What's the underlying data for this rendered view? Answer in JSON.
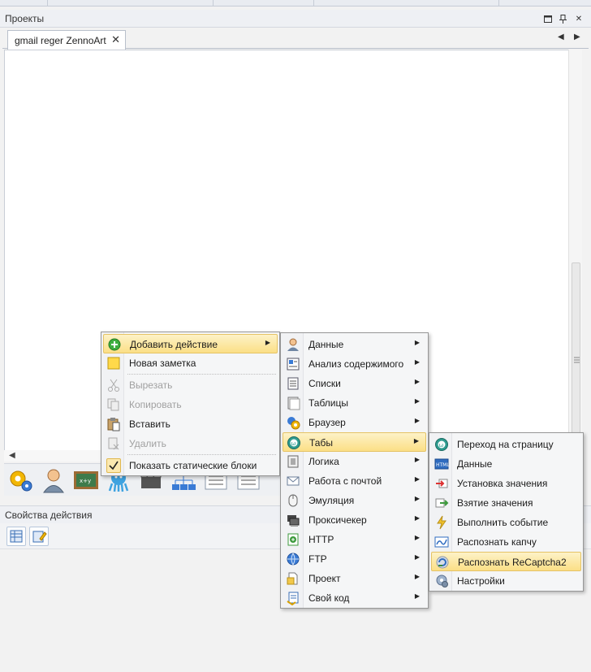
{
  "projects_panel": {
    "title": "Проекты",
    "tab_label": "gmail reger ZennoArt"
  },
  "props_panel": {
    "title": "Свойства действия"
  },
  "context_menu": {
    "items": [
      {
        "label": "Добавить действие",
        "icon": "add-icon",
        "submenu": true,
        "highlighted": true
      },
      {
        "label": "Новая заметка",
        "icon": "note-icon"
      },
      {
        "label": "Вырезать",
        "icon": "scissors-icon",
        "disabled": true
      },
      {
        "label": "Копировать",
        "icon": "copy-icon",
        "disabled": true
      },
      {
        "label": "Вставить",
        "icon": "paste-icon"
      },
      {
        "label": "Удалить",
        "icon": "delete-icon",
        "disabled": true
      },
      {
        "label": "Показать статические блоки",
        "icon": "check-icon",
        "checked": true
      }
    ]
  },
  "actions_submenu": {
    "items": [
      {
        "label": "Данные",
        "icon": "user-icon"
      },
      {
        "label": "Анализ содержимого",
        "icon": "analysis-icon"
      },
      {
        "label": "Списки",
        "icon": "list-icon"
      },
      {
        "label": "Таблицы",
        "icon": "table-icon"
      },
      {
        "label": "Браузер",
        "icon": "browser-icon"
      },
      {
        "label": "Табы",
        "icon": "tabs-icon",
        "highlighted": true
      },
      {
        "label": "Логика",
        "icon": "logic-icon"
      },
      {
        "label": "Работа с почтой",
        "icon": "mail-icon"
      },
      {
        "label": "Эмуляция",
        "icon": "mouse-icon"
      },
      {
        "label": "Проксичекер",
        "icon": "proxy-icon"
      },
      {
        "label": "HTTP",
        "icon": "http-icon"
      },
      {
        "label": "FTP",
        "icon": "ftp-icon"
      },
      {
        "label": "Проект",
        "icon": "project-icon"
      },
      {
        "label": "Свой код",
        "icon": "code-icon"
      }
    ]
  },
  "tabs_submenu": {
    "items": [
      {
        "label": "Переход на страницу",
        "icon": "navigate-icon"
      },
      {
        "label": "Данные",
        "icon": "html-icon"
      },
      {
        "label": "Установка значения",
        "icon": "set-value-icon"
      },
      {
        "label": "Взятие значения",
        "icon": "get-value-icon"
      },
      {
        "label": "Выполнить событие",
        "icon": "lightning-icon"
      },
      {
        "label": "Распознать капчу",
        "icon": "captcha-icon"
      },
      {
        "label": "Распознать ReCaptcha2",
        "icon": "recaptcha-icon",
        "highlighted": true
      },
      {
        "label": "Настройки",
        "icon": "settings-icon"
      }
    ]
  },
  "colors": {
    "highlight_top": "#fdf2c7",
    "highlight_bottom": "#fbdf86",
    "menu_bg": "#f5f6f7"
  }
}
